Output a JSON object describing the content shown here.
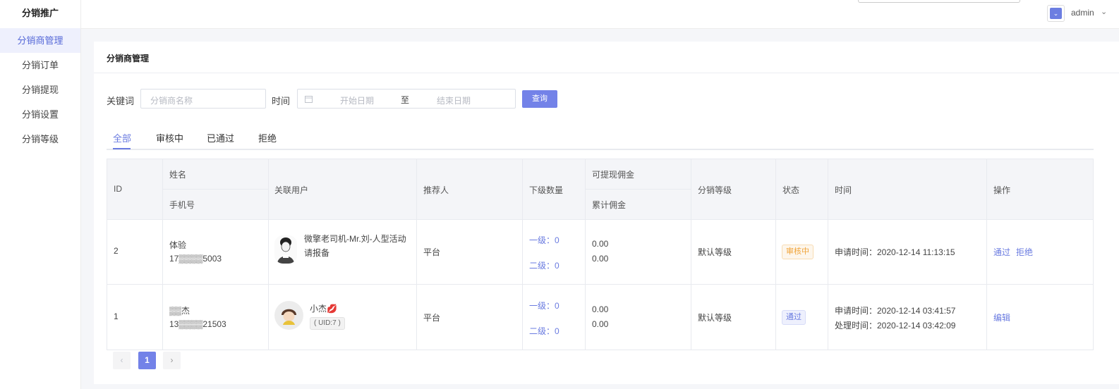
{
  "sidebar": {
    "title": "分销推广",
    "items": [
      {
        "label": "分销商管理",
        "active": true
      },
      {
        "label": "分销订单"
      },
      {
        "label": "分销提现"
      },
      {
        "label": "分销设置"
      },
      {
        "label": "分销等级"
      }
    ]
  },
  "header": {
    "user": "admin"
  },
  "card": {
    "title": "分销商管理"
  },
  "filters": {
    "keyword_label": "关键词",
    "keyword_placeholder": "分销商名称",
    "time_label": "时间",
    "start_placeholder": "开始日期",
    "range_sep": "至",
    "end_placeholder": "结束日期",
    "search_label": "查询"
  },
  "tabs": [
    "全部",
    "审核中",
    "已通过",
    "拒绝"
  ],
  "table": {
    "headers": {
      "id": "ID",
      "name": "姓名",
      "phone": "手机号",
      "user": "关联用户",
      "referrer": "推荐人",
      "sub_count": "下级数量",
      "withdrawable": "可提现佣金",
      "total": "累计佣金",
      "level": "分销等级",
      "status": "状态",
      "time": "时间",
      "action": "操作"
    },
    "rows": [
      {
        "id": "2",
        "name": "体验",
        "phone": "17▒▒▒▒5003",
        "user_line1": "微擎老司机-Mr.刘-人型活动",
        "user_line2": "请报备",
        "referrer": "平台",
        "level1": "一级：0",
        "level2": "二级：0",
        "withdrawable": "0.00",
        "total": "0.00",
        "level": "默认等级",
        "status": "审核中",
        "time1": "申请时间：2020-12-14 11:13:15",
        "actions": [
          "通过",
          "拒绝"
        ]
      },
      {
        "id": "1",
        "name": "▒▒杰",
        "phone": "13▒▒▒▒21503",
        "user_line1": "小杰💋",
        "uid": "( UID:7 )",
        "referrer": "平台",
        "level1": "一级：0",
        "level2": "二级：0",
        "withdrawable": "0.00",
        "total": "0.00",
        "level": "默认等级",
        "status": "通过",
        "time1": "申请时间：2020-12-14 03:41:57",
        "time2": "处理时间：2020-12-14 03:42:09",
        "actions": [
          "编辑"
        ]
      }
    ]
  },
  "pagination": {
    "prev": "‹",
    "current": "1",
    "next": "›"
  },
  "colors": {
    "accent": "#6a7be0",
    "button": "#7382e8",
    "pending": "#f0a43a",
    "passed": "#6a7be0"
  }
}
